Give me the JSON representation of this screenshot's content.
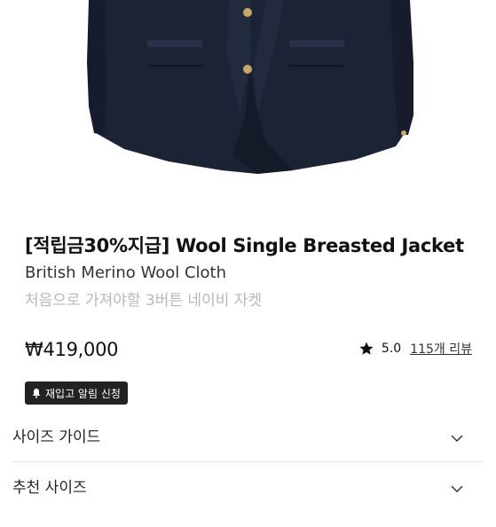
{
  "product": {
    "title": "[적립금30%지급] Wool Single Breasted Jacket",
    "subtitle": "British Merino Wool Cloth",
    "description": "처음으로 가져야할 3버튼 네이비 자켓",
    "price": "₩419,000",
    "rating": "5.0",
    "reviews_link": "115개 리뷰",
    "image_alt": "navy wool single breasted jacket"
  },
  "restock_button": {
    "label": "재입고 알림 신청",
    "icon": "bell-icon"
  },
  "accordions": [
    {
      "label": "사이즈 가이드",
      "icon": "chevron-down-icon"
    },
    {
      "label": "추천 사이즈",
      "icon": "chevron-down-icon"
    }
  ],
  "colors": {
    "jacket": "#1c2335",
    "button": "#c8a86a",
    "badge_bg": "#222222",
    "muted_text": "#b8b8b8"
  }
}
